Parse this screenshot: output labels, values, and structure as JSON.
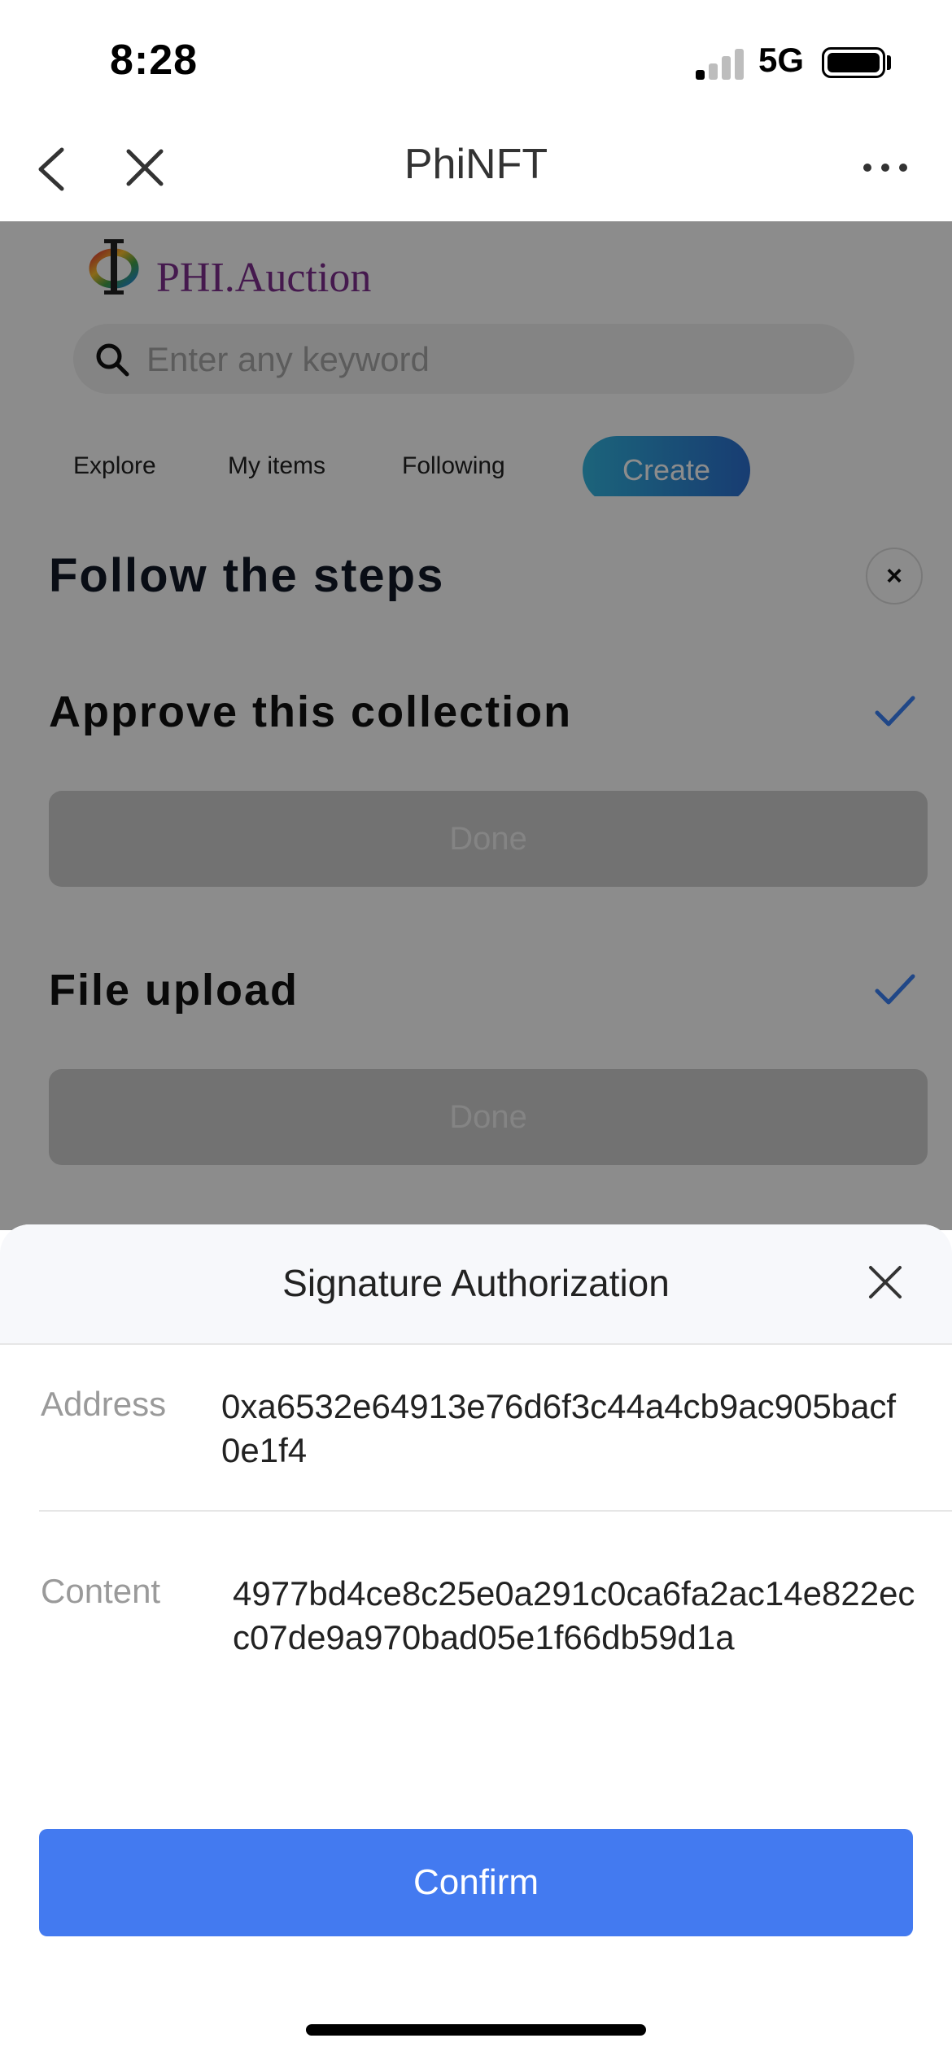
{
  "status_bar": {
    "time": "8:28",
    "network": "5G"
  },
  "nav": {
    "title": "PhiNFT"
  },
  "site": {
    "logo_text": "PHI.Auction",
    "search_placeholder": "Enter any keyword",
    "tabs": [
      "Explore",
      "My items",
      "Following"
    ],
    "create_label": "Create"
  },
  "steps_modal": {
    "title": "Follow the steps",
    "close_label": "×",
    "steps": [
      {
        "label": "Approve this collection",
        "button": "Done"
      },
      {
        "label": "File upload",
        "button": "Done"
      }
    ]
  },
  "signature_sheet": {
    "title": "Signature Authorization",
    "address_label": "Address",
    "address_value": "0xa6532e64913e76d6f3c44a4cb9ac905bacf0e1f4",
    "content_label": "Content",
    "content_value": "4977bd4ce8c25e0a291c0ca6fa2ac14e822ecc07de9a970bad05e1f66db59d1a",
    "confirm_label": "Confirm"
  },
  "colors": {
    "confirm": "#437af0",
    "logo_text": "#7e2f8e",
    "check": "#3b82f6"
  }
}
